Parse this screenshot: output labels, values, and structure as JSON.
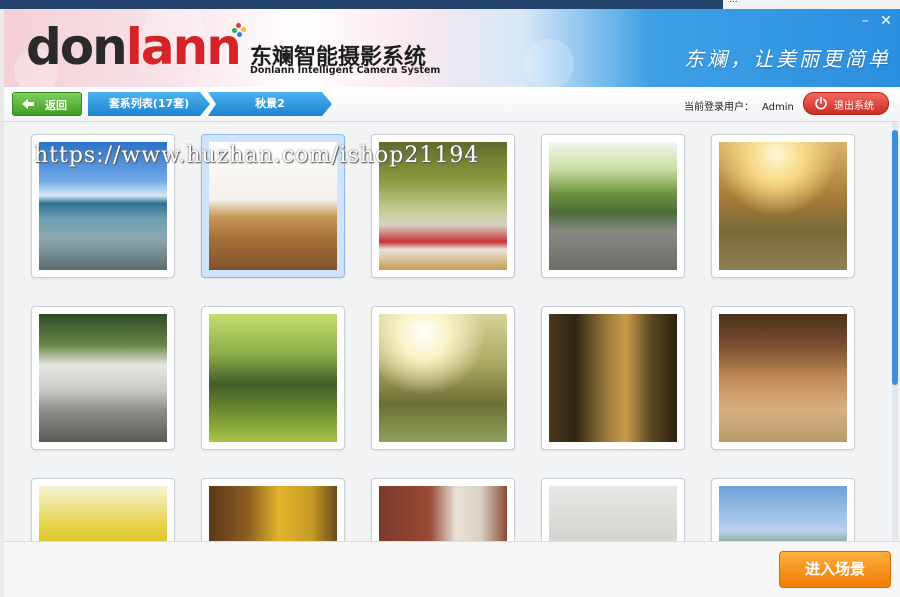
{
  "desktop": {
    "corner_text": "..."
  },
  "header": {
    "logo_main_a": "don",
    "logo_main_b": "lann",
    "logo_cn": "东斓智能摄影系统",
    "logo_en": "Donlann Intelligent Camera System",
    "slogan": "东斓，让美丽更简单",
    "minimize": "–",
    "close": "✕"
  },
  "toolbar": {
    "back_label": "返回",
    "crumbs": [
      "套系列表(17套)",
      "秋景2"
    ],
    "user_label": "当前登录用户：",
    "user_name": "Admin",
    "logout_label": "退出系统"
  },
  "watermark": "https://www.huzhan.com/ishop21194",
  "gallery": {
    "selected_index": 1,
    "items": [
      {
        "scene": "beach-sea"
      },
      {
        "scene": "dry-grass-field"
      },
      {
        "scene": "road-red-white-barrier"
      },
      {
        "scene": "park-stairs"
      },
      {
        "scene": "sunlit-cyclists"
      },
      {
        "scene": "white-gate-trees"
      },
      {
        "scene": "green-tree-grove"
      },
      {
        "scene": "sunlit-trees"
      },
      {
        "scene": "tree-lined-path"
      },
      {
        "scene": "brick-wall-sunlight"
      },
      {
        "scene": "yellow-ginkgo"
      },
      {
        "scene": "autumn-building"
      },
      {
        "scene": "brick-white-column"
      },
      {
        "scene": "white-wall-lamp"
      },
      {
        "scene": "dome-building-trees"
      }
    ]
  },
  "footer": {
    "enter_label": "进入场景"
  },
  "colors": {
    "accent_blue": "#2b8fe0",
    "back_green": "#3f9e25",
    "logout_red": "#cc2b22",
    "enter_orange": "#f07c00"
  }
}
